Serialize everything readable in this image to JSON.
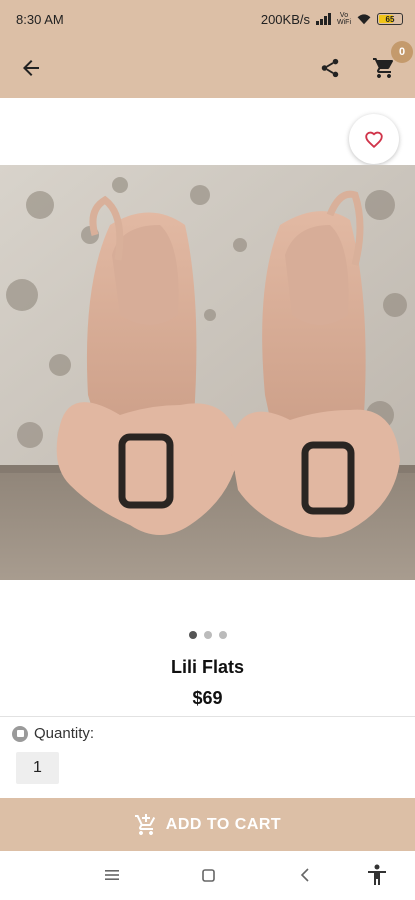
{
  "status_bar": {
    "time": "8:30 AM",
    "network_speed": "200KB/s",
    "vowifi_top": "Vo",
    "vowifi_bottom": "WiFi",
    "battery_level": "65"
  },
  "app_bar": {
    "back_icon": "arrow-left-icon",
    "share_icon": "share-icon",
    "cart_icon": "cart-icon",
    "cart_count": "0"
  },
  "product": {
    "name": "Lili Flats",
    "price": "$69",
    "favorite_icon": "heart-outline-icon",
    "image_count": 3,
    "active_image": 1
  },
  "quantity": {
    "label": "Quantity:",
    "value": "1"
  },
  "actions": {
    "add_to_cart_label": "ADD TO CART"
  },
  "colors": {
    "accent": "#dcbfa6",
    "badge": "#c49a6c",
    "heart": "#d0344a"
  }
}
